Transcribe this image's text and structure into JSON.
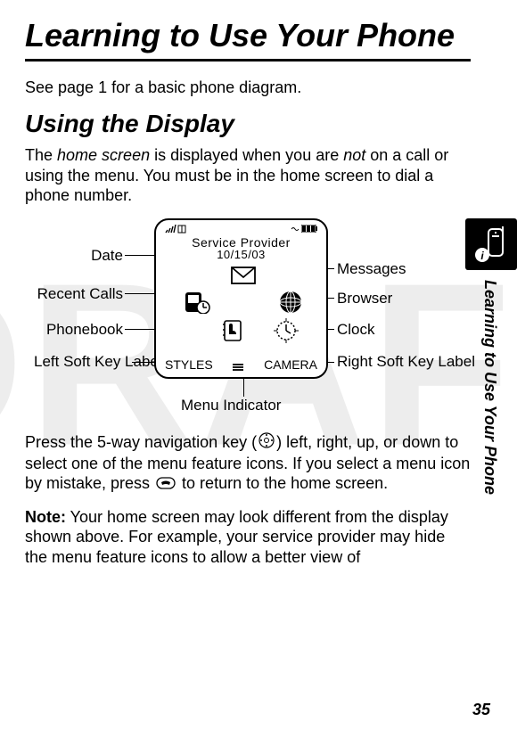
{
  "title": "Learning to Use Your Phone",
  "intro": "See page 1 for a basic phone diagram.",
  "section": "Using the Display",
  "para1_a": "The ",
  "para1_em1": "home screen",
  "para1_b": " is displayed when you are ",
  "para1_em2": "not",
  "para1_c": " on a call or using the menu. You must be in the home screen to dial a phone number.",
  "para2_a": "Press the 5-way navigation key (",
  "para2_b": ") left, right, up, or down to select one of the menu feature icons. If you select a menu icon by mistake, press ",
  "para2_c": " to return to the home screen.",
  "note_label": "Note:",
  "note_text": " Your home screen may look different from the display shown above. For example, your service provider may hide the menu feature icons to allow a better view of",
  "vertical_caption": "Learning to Use Your Phone",
  "pagenum": "35",
  "screen": {
    "provider": "Service Provider",
    "date": "10/15/03",
    "left_soft": "STYLES",
    "right_soft": "CAMERA"
  },
  "labels": {
    "date": "Date",
    "recent_calls": "Recent Calls",
    "phonebook": "Phonebook",
    "left_soft": "Left Soft Key Label",
    "menu_indicator": "Menu Indicator",
    "messages": "Messages",
    "browser": "Browser",
    "clock": "Clock",
    "right_soft": "Right Soft Key Label"
  },
  "watermark": "DRAFT"
}
